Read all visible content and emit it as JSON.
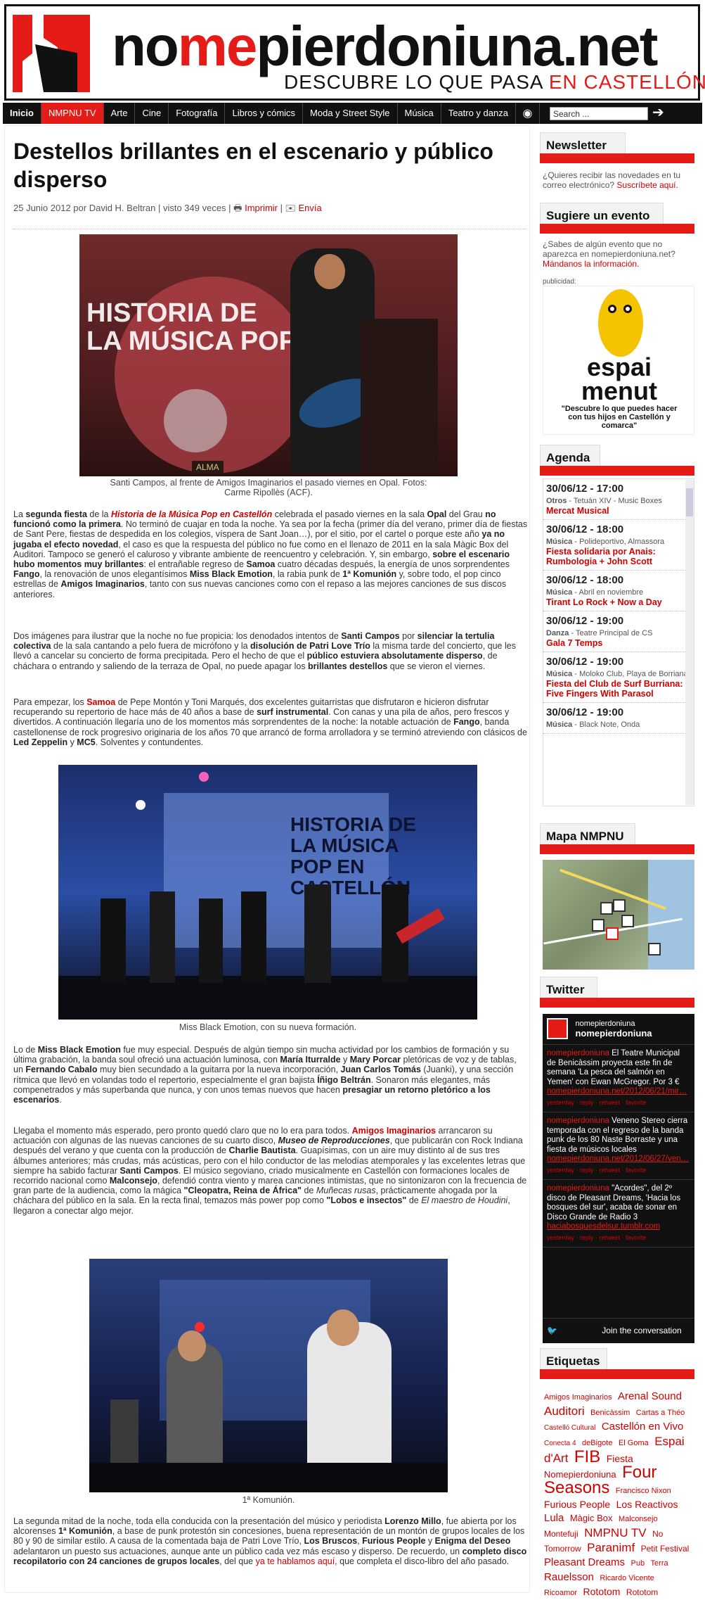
{
  "header": {
    "brand_part1": "no",
    "brand_part2": "me",
    "brand_part3": "pierdoniuna.net",
    "tagline_part1": "DESCUBRE LO QUE PASA",
    "tagline_part2": "EN CASTELLÓN"
  },
  "nav": {
    "items": [
      "Inicio",
      "NMPNU TV",
      "Arte",
      "Cine",
      "Fotografía",
      "Libros y cómics",
      "Moda y Street Style",
      "Música",
      "Teatro y danza"
    ],
    "search_placeholder": "Search ..."
  },
  "article": {
    "title": "Destellos brillantes en el escenario y público disperso",
    "meta": "25 Junio 2012 por David H. Beltran | visto 349 veces |",
    "print_label": "Imprimir",
    "send_label": "Envía",
    "caption1_line1": "Santi Campos, al frente de Amigos Imaginarios el pasado viernes en Opal. Fotos:",
    "caption1_line2": "Carme Ripollès (ACF).",
    "caption2": "Miss Black Emotion, con su nueva formación.",
    "caption3": "1ª Komunión.",
    "photo1_banner": "HISTORIA DE LA MÚSICA POP",
    "photo1_label": "ALMA",
    "photo2_banner": "HISTORIA DE LA MÚSICA POP EN CASTELLÓN"
  },
  "sidebar": {
    "newsletter_title": "Newsletter",
    "newsletter_text": "¿Quieres recibir las novedades en tu correo electrónico?",
    "newsletter_link": "Suscríbete aquí.",
    "suggest_title": "Sugiere un evento",
    "suggest_text": "¿Sabes de algún evento que no aparezca en nomepierdoniuna.net?",
    "suggest_link": "Mándanos la información.",
    "ad_label": "publicidad:",
    "ad_brand_line1": "espai",
    "ad_brand_line2": "menut",
    "ad_text": "\"Descubre lo que puedes hacer con tus hijos en Castellón y comarca\"",
    "agenda_title": "Agenda",
    "agenda": [
      {
        "date": "30/06/12 - 17:00",
        "cat": "Otros",
        "place": " - Tetuán XIV - Music Boxes",
        "title": "Mercat Musical"
      },
      {
        "date": "30/06/12 - 18:00",
        "cat": "Música",
        "place": " - Polideportivo, Almassora",
        "title": "Fiesta solidaria por Anais: Rumbologia + John Scott"
      },
      {
        "date": "30/06/12 - 18:00",
        "cat": "Música",
        "place": " - Abril en noviembre",
        "title": "Tirant Lo Rock + Now a Day"
      },
      {
        "date": "30/06/12 - 19:00",
        "cat": "Danza",
        "place": " - Teatre Principal de CS",
        "title": "Gala 7 Temps"
      },
      {
        "date": "30/06/12 - 19:00",
        "cat": "Música",
        "place": " - Moloko Club, Playa de Borriana",
        "title": "Fiesta del Club de Surf Burriana: Five Fingers With Parasol"
      },
      {
        "date": "30/06/12 - 19:00",
        "cat": "Música",
        "place": " - Black Note, Onda",
        "title": ""
      }
    ],
    "map_title": "Mapa NMPNU",
    "twitter_title": "Twitter",
    "tw_user": "nomepierdoniuna",
    "tw_user_bold": "nomepierdoniuna",
    "tweets": [
      {
        "user": "nomepierdoniuna",
        "text": " El Teatre Municipal de Benicàssim proyecta este fin de semana 'La pesca del salmón en Yemen' con Ewan McGregor. Por 3 €",
        "link": "nomepierdoniuna.net/2012/06/21/mir…",
        "meta": "yesterday · reply · retweet · favorite"
      },
      {
        "user": "nomepierdoniuna",
        "text": " Veneno Stereo cierra temporada con el regreso de la banda punk de los 80 Naste Borraste y una fiesta de músicos locales",
        "link": "nomepierdoniuna.net/2012/06/27/ven…",
        "meta": "yesterday · reply · retweet · favorite"
      },
      {
        "user": "nomepierdoniuna",
        "text": " \"Acordes\", del 2º disco de Pleasant Dreams, 'Hacia los bosques del sur', acaba de sonar en Disco Grande de Radio 3",
        "link": "haciabosquesdelsur.tumblr.com",
        "meta": "yesterday · reply · retweet · favorite"
      }
    ],
    "tw_join": "Join the conversation",
    "tags_title": "Etiquetas",
    "tags": [
      {
        "t": "Amigos Imaginarios",
        "s": 11
      },
      {
        "t": "Arenal Sound",
        "s": 15
      },
      {
        "t": "Auditori",
        "s": 17
      },
      {
        "t": "Benicàssim",
        "s": 11
      },
      {
        "t": "Cartas a Théo",
        "s": 11
      },
      {
        "t": "Castelló Cultural",
        "s": 10
      },
      {
        "t": "Castellón en Vivo",
        "s": 15
      },
      {
        "t": "Conecta 4",
        "s": 10
      },
      {
        "t": "deBigote",
        "s": 11
      },
      {
        "t": "El Goma",
        "s": 11
      },
      {
        "t": "Espai d'Art",
        "s": 17
      },
      {
        "t": "FIB",
        "s": 24
      },
      {
        "t": "Fiesta",
        "s": 14
      },
      {
        "t": "Nomepierdoniuna",
        "s": 13
      },
      {
        "t": "Four Seasons",
        "s": 24
      },
      {
        "t": "Francisco Nixon",
        "s": 11
      },
      {
        "t": "Furious People",
        "s": 14
      },
      {
        "t": "Los Reactivos",
        "s": 14
      },
      {
        "t": "Lula",
        "s": 15
      },
      {
        "t": "Màgic Box",
        "s": 13
      },
      {
        "t": "Malconsejo",
        "s": 11
      },
      {
        "t": "Montefuji",
        "s": 12
      },
      {
        "t": "NMPNU TV",
        "s": 17
      },
      {
        "t": "No Tomorrow",
        "s": 12
      },
      {
        "t": "Paranimf",
        "s": 17
      },
      {
        "t": "Petit Festival",
        "s": 12
      },
      {
        "t": "Pleasant Dreams",
        "s": 15
      },
      {
        "t": "Pub",
        "s": 11
      },
      {
        "t": "Terra",
        "s": 11
      },
      {
        "t": "Rauelsson",
        "s": 15
      },
      {
        "t": "Ricardo Vicente",
        "s": 11
      },
      {
        "t": "Ricoamor",
        "s": 11
      },
      {
        "t": "Rototom",
        "s": 14
      },
      {
        "t": "Rototom",
        "s": 12
      }
    ]
  }
}
